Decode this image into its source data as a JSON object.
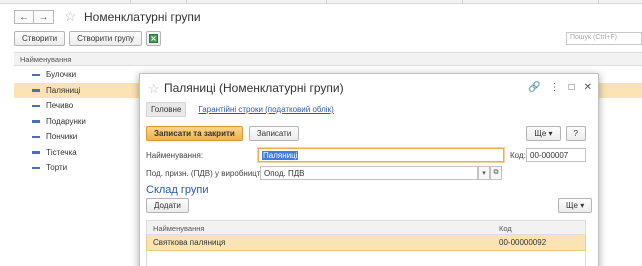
{
  "main": {
    "title": "Номенклатурні групи",
    "back_glyph": "←",
    "forward_glyph": "→",
    "create_label": "Створити",
    "create_group_label": "Створити групу",
    "search_placeholder": "Пошук (Ctrl+F)",
    "column_header": "Найменування",
    "items": [
      {
        "label": "Булочки",
        "selected": false
      },
      {
        "label": "Паляниці",
        "selected": true
      },
      {
        "label": "Печиво",
        "selected": false
      },
      {
        "label": "Подарунки",
        "selected": false
      },
      {
        "label": "Пончики",
        "selected": false
      },
      {
        "label": "Тістечка",
        "selected": false
      },
      {
        "label": "Торти",
        "selected": false
      }
    ]
  },
  "modal": {
    "title": "Паляниці (Номенклатурні групи)",
    "tabs": {
      "main": "Головне",
      "warranty": "Гарантійні строки (податковий облік)"
    },
    "save_close_label": "Записати та закрити",
    "save_label": "Записати",
    "more_label": "Ще",
    "help_label": "?",
    "name_label": "Найменування:",
    "name_value": "Паляниці",
    "code_label": "Код:",
    "code_value": "00-000007",
    "vat_label": "Под. призн. (ПДВ) у виробництві:",
    "vat_value": "Опод. ПДВ",
    "section_title": "Склад групи",
    "add_label": "Додати",
    "table": {
      "headers": [
        "Найменування",
        "Код"
      ],
      "rows": [
        {
          "name": "Святкова паляниця",
          "code": "00-00000092"
        }
      ]
    }
  },
  "colors": {
    "accent_orange": "#f0b24a",
    "selection_row": "#fbe3b3",
    "link_blue": "#2a5aa5",
    "item_marker": "#4a6fb8"
  }
}
